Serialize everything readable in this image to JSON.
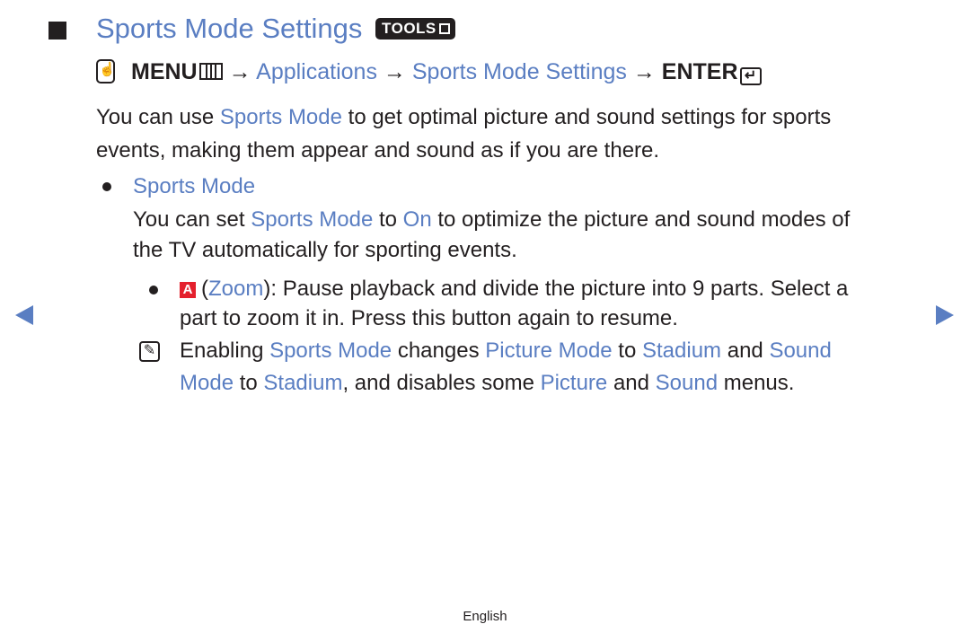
{
  "heading": {
    "title": "Sports Mode Settings",
    "tools_badge": "TOOLS"
  },
  "menu_path": {
    "menu": "MENU",
    "arrow": "→",
    "step1": "Applications",
    "step2": "Sports Mode Settings",
    "enter": "ENTER"
  },
  "intro": {
    "line1_pre": "You can use ",
    "line1_hl": "Sports Mode",
    "line1_post": " to get optimal picture and sound settings for sports",
    "line2": "events, making them appear and sound as if you are there."
  },
  "sports_mode": {
    "heading": "Sports Mode",
    "line1_a": "You can set ",
    "line1_hl1": "Sports Mode",
    "line1_b": " to ",
    "line1_hl2": "On",
    "line1_c": " to optimize the picture and sound modes of",
    "line2": "the TV automatically for sporting events."
  },
  "zoom_item": {
    "badge": "A",
    "open": "(",
    "label": "Zoom",
    "line1_post": "): Pause playback and divide the picture into 9 parts. Select a",
    "line2": "part to zoom it in. Press this button again to resume."
  },
  "note": {
    "l1_a": "Enabling ",
    "l1_hl1": "Sports Mode",
    "l1_b": " changes ",
    "l1_hl2": "Picture Mode",
    "l1_c": " to ",
    "l1_hl3": "Stadium",
    "l1_d": " and ",
    "l1_hl4": "Sound",
    "l2_hl1": "Mode",
    "l2_a": " to ",
    "l2_hl2": "Stadium",
    "l2_b": ", and disables some ",
    "l2_hl3": "Picture",
    "l2_c": " and ",
    "l2_hl4": "Sound",
    "l2_d": " menus."
  },
  "footer": {
    "language": "English"
  },
  "colors": {
    "accent": "#5a7ec2",
    "text": "#231f20",
    "a_button": "#e4202d"
  }
}
